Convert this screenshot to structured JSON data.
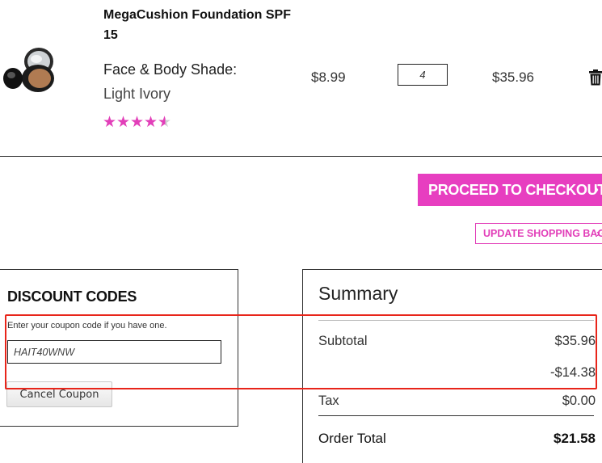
{
  "product": {
    "name": "MegaCushion Foundation SPF 15",
    "shade_label": "Face & Body Shade:",
    "shade_value": "Light Ivory",
    "rating": 4.5,
    "unit_price": "$8.99",
    "quantity": "4",
    "line_total": "$35.96"
  },
  "actions": {
    "checkout_label": "PROCEED TO CHECKOUT",
    "checkout_chevron": "›",
    "update_label": "UPDATE SHOPPING BAG",
    "update_chevron": "›"
  },
  "discount": {
    "title": "DISCOUNT CODES",
    "hint": "Enter your coupon code if you have one.",
    "coupon_value": "HAIT40WNW",
    "cancel_label": "Cancel Coupon"
  },
  "summary": {
    "title": "Summary",
    "subtotal_label": "Subtotal",
    "subtotal_value": "$35.96",
    "discount_value": "-$14.38",
    "tax_label": "Tax",
    "tax_value": "$0.00",
    "total_label": "Order Total",
    "total_value": "$21.58"
  },
  "colors": {
    "accent": "#e73ec0",
    "highlight": "#e8251a"
  },
  "icons": {
    "product_image": "cushion-compact-icon",
    "delete": "trash-icon",
    "star": "star-icon"
  }
}
